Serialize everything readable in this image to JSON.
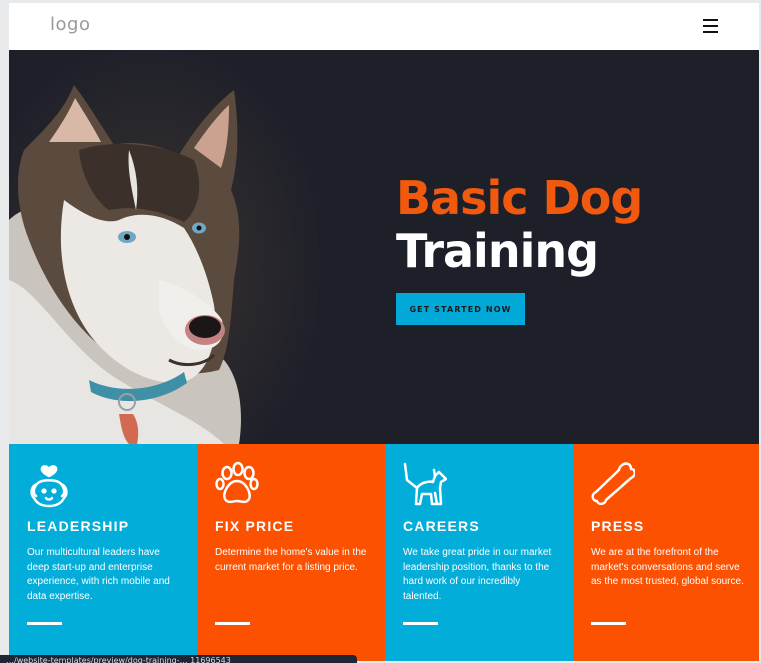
{
  "header": {
    "logo": "logo",
    "menu_icon": "hamburger-menu-icon"
  },
  "hero": {
    "title_line1": "Basic Dog",
    "title_line2": "Training",
    "cta_label": "GET STARTED NOW",
    "image": "husky-dog-portrait",
    "background_color": "#1d1f29",
    "accent_color": "#f15a0e",
    "cta_color": "#02a9d8"
  },
  "features": [
    {
      "icon": "dog-heart-icon",
      "title": "LEADERSHIP",
      "description": "Our multicultural leaders have deep start-up and enterprise experience, with rich mobile and data expertise.",
      "color": "#02aed9"
    },
    {
      "icon": "paw-icon",
      "title": "FIX PRICE",
      "description": "Determine the home's value in the current market for a listing price.",
      "color": "#fc5100"
    },
    {
      "icon": "dog-leash-icon",
      "title": "CAREERS",
      "description": "We take great pride in our market leadership position, thanks to the hard work of our incredibly talented.",
      "color": "#02aed9"
    },
    {
      "icon": "bone-icon",
      "title": "PRESS",
      "description": "We are at the forefront of the market's conversations and serve as the most trusted, global source.",
      "color": "#fc5100"
    }
  ],
  "status_bar": {
    "url": "…/website-templates/preview/dog-training-…  11696543"
  }
}
